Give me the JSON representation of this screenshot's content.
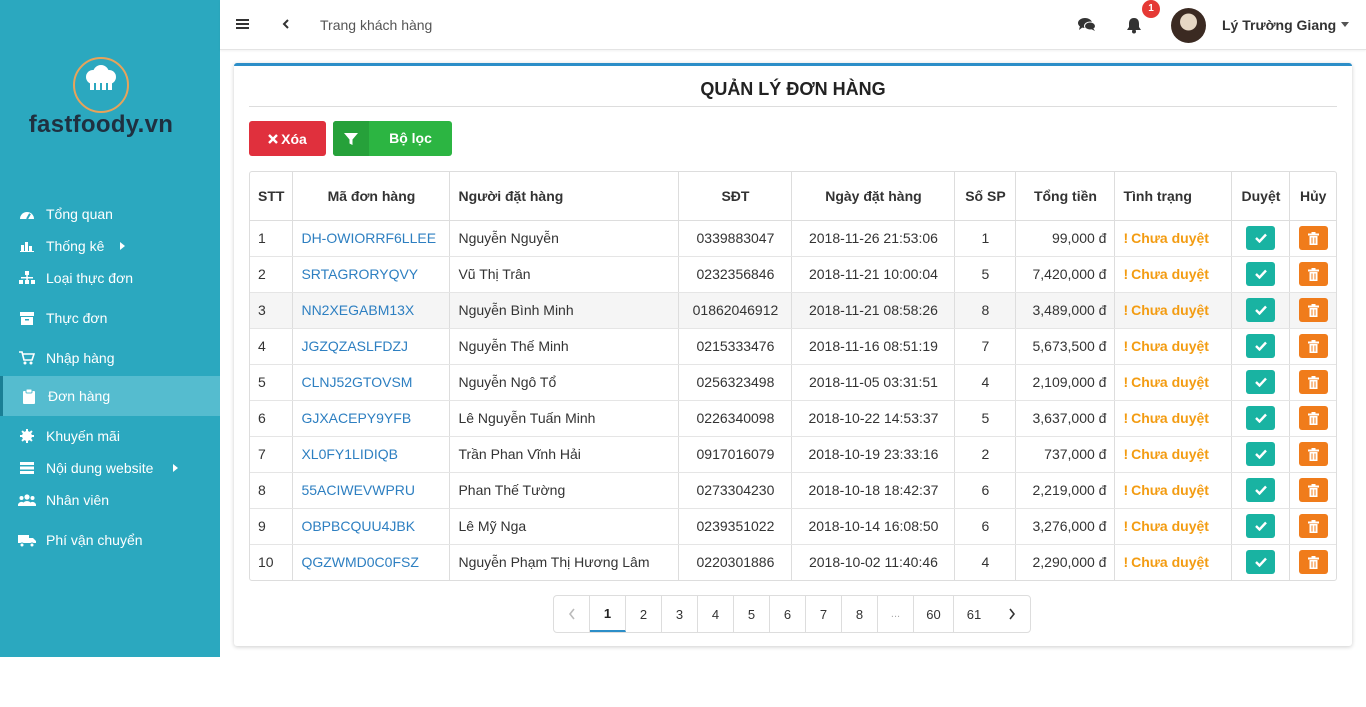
{
  "brand": {
    "name": "fastfoody.vn"
  },
  "sidebar": {
    "items": [
      {
        "label": "Tổng quan",
        "icon": "dashboard-icon"
      },
      {
        "label": "Thống kê",
        "icon": "bar-chart-icon",
        "has_submenu": true
      },
      {
        "label": "Loại thực đơn",
        "icon": "sitemap-icon"
      },
      {
        "label": "Thực đơn",
        "icon": "box-icon"
      },
      {
        "label": "Nhập hàng",
        "icon": "cart-icon"
      },
      {
        "label": "Đơn hàng",
        "icon": "clipboard-icon",
        "active": true
      },
      {
        "label": "Khuyến mãi",
        "icon": "gear-badge-icon"
      },
      {
        "label": "Nội dung website",
        "icon": "list-icon",
        "has_submenu": true
      },
      {
        "label": "Nhân viên",
        "icon": "users-icon"
      },
      {
        "label": "Phí vận chuyển",
        "icon": "truck-icon"
      }
    ]
  },
  "topbar": {
    "breadcrumb": "Trang khách hàng",
    "notification_count": "1",
    "user_name": "Lý Trường Giang"
  },
  "page": {
    "title": "QUẢN LÝ ĐƠN HÀNG",
    "delete_label": "Xóa",
    "filter_label": "Bộ lọc"
  },
  "table": {
    "columns": [
      "STT",
      "Mã đơn hàng",
      "Người đặt hàng",
      "SĐT",
      "Ngày đặt hàng",
      "Số SP",
      "Tổng tiền",
      "Tình trạng",
      "Duyệt",
      "Hủy"
    ],
    "rows": [
      {
        "stt": "1",
        "code": "DH-OWIORRF6LLEE",
        "customer": "Nguyễn Nguyễn",
        "phone": "0339883047",
        "date": "2018-11-26 21:53:06",
        "qty": "1",
        "total": "99,000 đ",
        "status": "Chưa duyệt"
      },
      {
        "stt": "2",
        "code": "SRTAGRORYQVY",
        "customer": "Vũ Thị Trân",
        "phone": "0232356846",
        "date": "2018-11-21 10:00:04",
        "qty": "5",
        "total": "7,420,000 đ",
        "status": "Chưa duyệt"
      },
      {
        "stt": "3",
        "code": "NN2XEGABM13X",
        "customer": "Nguyễn Bình Minh",
        "phone": "01862046912",
        "date": "2018-11-21 08:58:26",
        "qty": "8",
        "total": "3,489,000 đ",
        "status": "Chưa duyệt"
      },
      {
        "stt": "4",
        "code": "JGZQZASLFDZJ",
        "customer": "Nguyễn Thế Minh",
        "phone": "0215333476",
        "date": "2018-11-16 08:51:19",
        "qty": "7",
        "total": "5,673,500 đ",
        "status": "Chưa duyệt"
      },
      {
        "stt": "5",
        "code": "CLNJ52GTOVSM",
        "customer": "Nguyễn Ngô Tổ",
        "phone": "0256323498",
        "date": "2018-11-05 03:31:51",
        "qty": "4",
        "total": "2,109,000 đ",
        "status": "Chưa duyệt"
      },
      {
        "stt": "6",
        "code": "GJXACEPY9YFB",
        "customer": "Lê Nguyễn Tuấn Minh",
        "phone": "0226340098",
        "date": "2018-10-22 14:53:37",
        "qty": "5",
        "total": "3,637,000 đ",
        "status": "Chưa duyệt"
      },
      {
        "stt": "7",
        "code": "XL0FY1LIDIQB",
        "customer": "Trần Phan Vĩnh Hải",
        "phone": "0917016079",
        "date": "2018-10-19 23:33:16",
        "qty": "2",
        "total": "737,000 đ",
        "status": "Chưa duyệt"
      },
      {
        "stt": "8",
        "code": "55ACIWEVWPRU",
        "customer": "Phan Thế Tường",
        "phone": "0273304230",
        "date": "2018-10-18 18:42:37",
        "qty": "6",
        "total": "2,219,000 đ",
        "status": "Chưa duyệt"
      },
      {
        "stt": "9",
        "code": "OBPBCQUU4JBK",
        "customer": "Lê Mỹ Nga",
        "phone": "0239351022",
        "date": "2018-10-14 16:08:50",
        "qty": "6",
        "total": "3,276,000 đ",
        "status": "Chưa duyệt"
      },
      {
        "stt": "10",
        "code": "QGZWMD0C0FSZ",
        "customer": "Nguyễn Phạm Thị Hương Lâm",
        "phone": "0220301886",
        "date": "2018-10-02 11:40:46",
        "qty": "4",
        "total": "2,290,000 đ",
        "status": "Chưa duyệt"
      }
    ]
  },
  "pagination": {
    "pages": [
      "1",
      "2",
      "3",
      "4",
      "5",
      "6",
      "7",
      "8",
      "...",
      "60",
      "61"
    ],
    "current": "1"
  },
  "colors": {
    "sidebar_bg": "#2ba8bf",
    "accent": "#2c8ec8",
    "danger": "#e0303d",
    "success": "#2cb542",
    "approve": "#19b3a2",
    "cancel": "#f07c1b",
    "pending": "#f39c12",
    "link": "#2d7fc1"
  }
}
